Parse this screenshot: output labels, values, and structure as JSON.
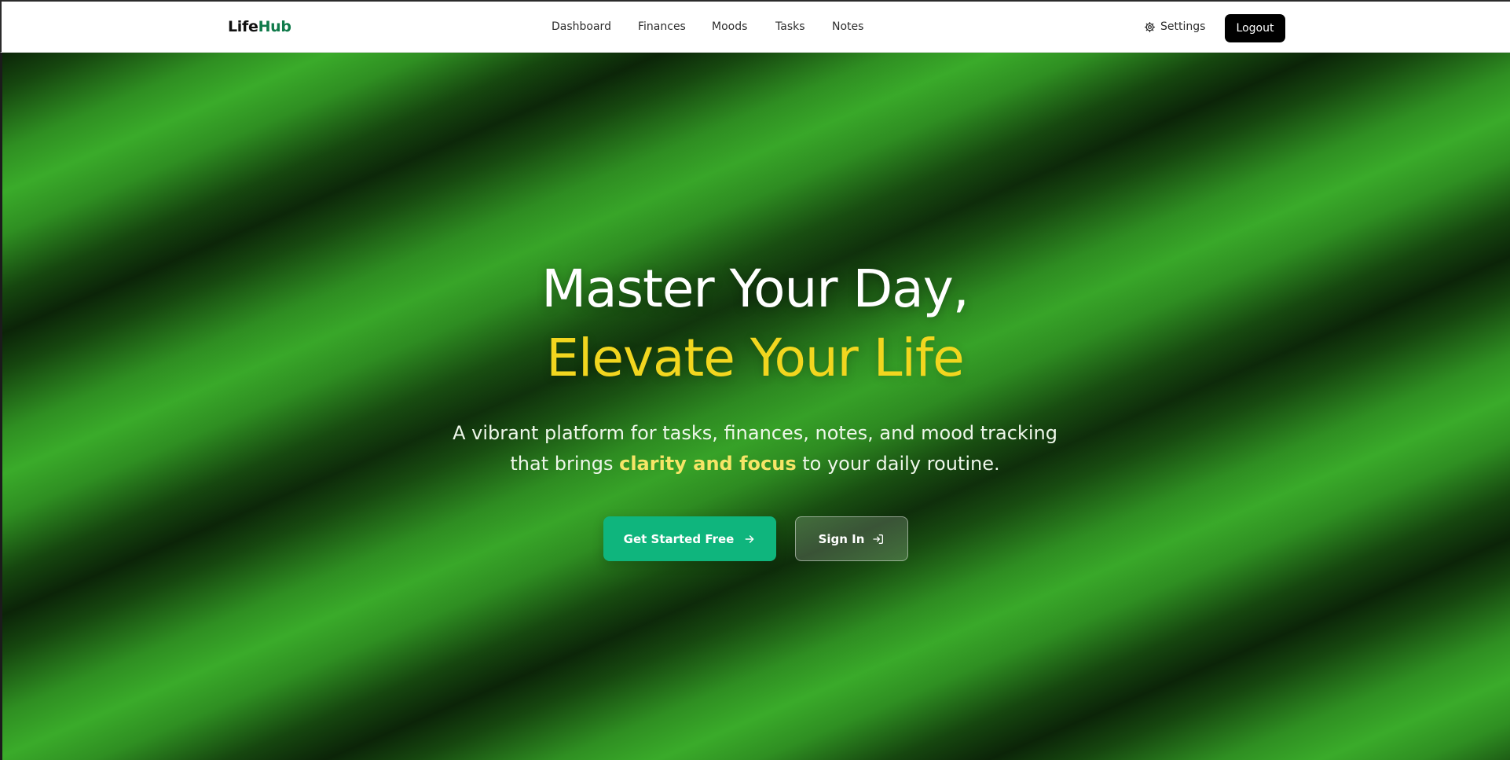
{
  "brand": {
    "part1": "Life",
    "part2": "Hub"
  },
  "nav": {
    "links": [
      {
        "label": "Dashboard"
      },
      {
        "label": "Finances"
      },
      {
        "label": "Moods"
      },
      {
        "label": "Tasks"
      },
      {
        "label": "Notes"
      }
    ],
    "settings_label": "Settings",
    "logout_label": "Logout"
  },
  "hero": {
    "headline_line1": "Master Your Day,",
    "headline_line2": "Elevate Your Life",
    "subtext_before": "A vibrant platform for tasks, finances, notes, and mood tracking that brings ",
    "subtext_highlight": "clarity and focus",
    "subtext_after": " to your daily routine.",
    "primary_cta": "Get Started Free",
    "secondary_cta": "Sign In"
  },
  "colors": {
    "brand_accent": "#0f7a4a",
    "headline_accent": "#f2d61f",
    "primary_button": "#0fb57d",
    "logout_button": "#000000"
  },
  "icons": {
    "settings": "gear-icon",
    "primary_cta": "arrow-right-icon",
    "secondary_cta": "sign-in-icon"
  }
}
